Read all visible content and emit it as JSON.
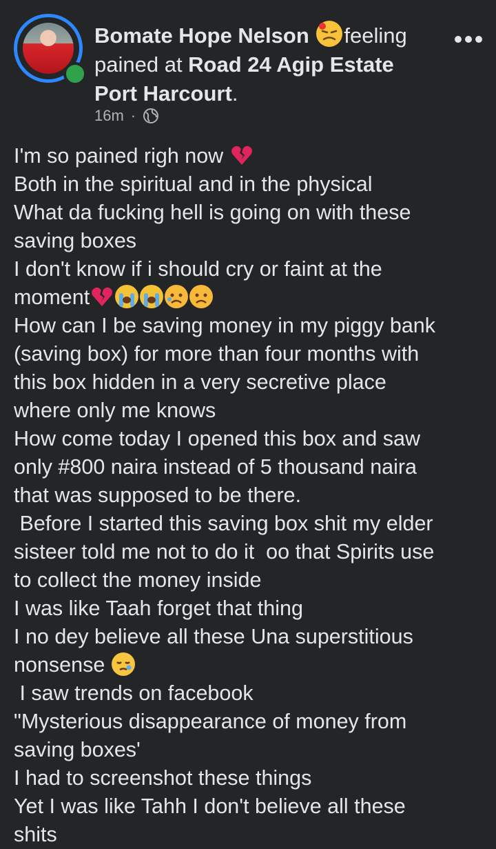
{
  "post": {
    "author": "Bomate Hope Nelson",
    "feeling_word": "feeling",
    "feeling_rest": "pained at ",
    "location": "Road 24 Agip Estate Port Harcourt",
    "period": ".",
    "time": "16m",
    "separator": "·",
    "privacy_icon": "globe-icon",
    "more_icon": "more-options-icon"
  },
  "body": {
    "lines": [
      "I'm so pained righ now",
      "Both in the spiritual and in the physical",
      "What da fucking hell is going on with these",
      "saving boxes",
      "I don't know if i should cry or faint at the",
      "moment",
      "How can I be saving money in my piggy bank",
      "(saving box) for more than four months with",
      "this box hidden in a very secretive place",
      "where only me knows",
      "How come today I opened this box and saw",
      "only #800 naira instead of 5 thousand naira",
      "that was supposed to be there.",
      " Before I started this saving box shit my elder",
      "sisteer told me not to do it  oo that Spirits use",
      "to collect the money inside",
      "I was like Taah forget that thing",
      "I no dey believe all these Una superstitious",
      "nonsense",
      " I saw trends on facebook",
      "\"Mysterious disappearance of money from",
      "saving boxes'",
      "I had to screenshot these things",
      "Yet I was like Tahh I don't believe all these",
      "shits"
    ]
  },
  "colors": {
    "background": "#242526",
    "text": "#e4e6eb",
    "secondary_text": "#b0b3b8",
    "story_ring": "#2d88ff",
    "online": "#31a24c"
  }
}
